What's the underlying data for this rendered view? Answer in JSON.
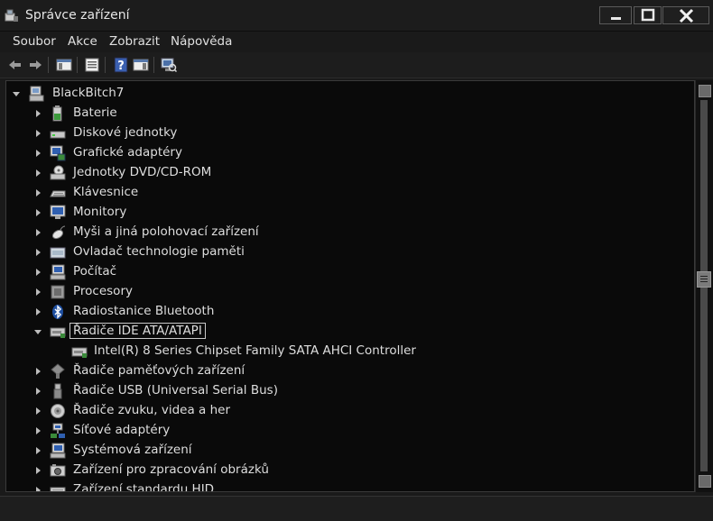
{
  "window": {
    "title": "Správce zařízení",
    "minimize_label": "",
    "maximize_label": "",
    "close_label": ""
  },
  "menu": {
    "items": [
      "Soubor",
      "Akce",
      "Zobrazit",
      "Nápověda"
    ]
  },
  "toolbar": {
    "buttons": [
      "back-icon",
      "forward-icon",
      "show-hide-console-tree-icon",
      "properties-icon",
      "help-icon",
      "action-pane-icon",
      "scan-hardware-icon"
    ]
  },
  "tree": {
    "root": "BlackBitch7",
    "items": [
      {
        "label": "Baterie",
        "icon": "battery-icon",
        "expanded": false
      },
      {
        "label": "Diskové jednotky",
        "icon": "disk-drive-icon",
        "expanded": false
      },
      {
        "label": "Grafické adaptéry",
        "icon": "display-adapter-icon",
        "expanded": false
      },
      {
        "label": "Jednotky DVD/CD-ROM",
        "icon": "dvd-drive-icon",
        "expanded": false
      },
      {
        "label": "Klávesnice",
        "icon": "keyboard-icon",
        "expanded": false
      },
      {
        "label": "Monitory",
        "icon": "monitor-icon",
        "expanded": false
      },
      {
        "label": "Myši a jiná polohovací zařízení",
        "icon": "mouse-icon",
        "expanded": false
      },
      {
        "label": "Ovladač technologie paměti",
        "icon": "memory-controller-icon",
        "expanded": false
      },
      {
        "label": "Počítač",
        "icon": "computer-icon",
        "expanded": false
      },
      {
        "label": "Procesory",
        "icon": "processor-icon",
        "expanded": false
      },
      {
        "label": "Radiostanice Bluetooth",
        "icon": "bluetooth-icon",
        "expanded": false
      },
      {
        "label": "Řadiče IDE ATA/ATAPI",
        "icon": "ide-controller-icon",
        "expanded": true,
        "selected": true
      },
      {
        "label": "Intel(R) 8 Series Chipset Family SATA AHCI Controller",
        "icon": "ide-controller-icon",
        "child": true
      },
      {
        "label": "Řadiče paměťových zařízení",
        "icon": "storage-controller-icon",
        "expanded": false
      },
      {
        "label": "Řadiče USB (Universal Serial Bus)",
        "icon": "usb-icon",
        "expanded": false
      },
      {
        "label": "Řadiče zvuku, videa a her",
        "icon": "sound-icon",
        "expanded": false
      },
      {
        "label": "Síťové adaptéry",
        "icon": "network-adapter-icon",
        "expanded": false
      },
      {
        "label": "Systémová zařízení",
        "icon": "system-device-icon",
        "expanded": false
      },
      {
        "label": "Zařízení pro zpracování obrázků",
        "icon": "imaging-device-icon",
        "expanded": false
      },
      {
        "label": "Zařízení standardu HID",
        "icon": "hid-icon",
        "expanded": false
      }
    ]
  },
  "status": {
    "text": ""
  }
}
